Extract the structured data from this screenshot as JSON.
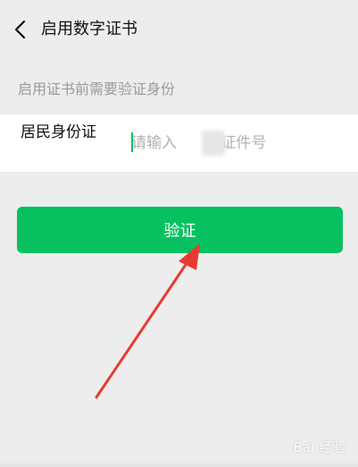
{
  "header": {
    "title": "启用数字证书",
    "back_icon": "chevron-left-icon"
  },
  "hint": "启用证书前需要验证身份",
  "field": {
    "label": "居民身份证",
    "placeholder": "请输入      的证件号",
    "value": ""
  },
  "button": {
    "label": "验证"
  },
  "watermark": "Bai 经验",
  "colors": {
    "accent": "#07c160",
    "background": "#ededed",
    "arrow": "#e83a31"
  }
}
